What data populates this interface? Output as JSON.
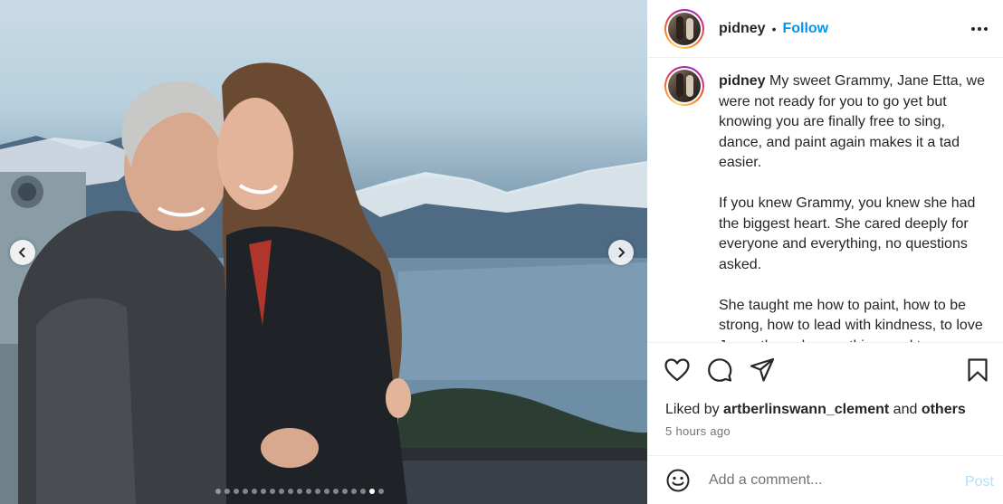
{
  "media": {
    "carousel_total": 19,
    "carousel_active_index": 17,
    "prev_icon": "chevron-left-icon",
    "next_icon": "chevron-right-icon"
  },
  "header": {
    "username": "pidney",
    "separator": "•",
    "follow_label": "Follow",
    "more_icon": "more-options-icon"
  },
  "caption": {
    "username": "pidney",
    "paragraphs": [
      "My sweet Grammy, Jane Etta, we were not ready for you to go yet but knowing you are finally free to sing, dance, and paint again makes it a tad easier.",
      "If you knew Grammy, you knew she had the biggest heart. She cared deeply for everyone and everything, no questions asked.",
      "She taught me how to paint, how to be strong, how to lead with kindness, to love Jesus through everything, and to"
    ]
  },
  "actions": {
    "like_icon": "heart-icon",
    "comment_icon": "comment-icon",
    "share_icon": "share-icon",
    "save_icon": "bookmark-icon"
  },
  "likes": {
    "prefix": "Liked by",
    "user": "artberlinswann_clement",
    "conjunction": "and",
    "others": "others"
  },
  "timestamp": "5 hours ago",
  "comment": {
    "emoji_icon": "emoji-icon",
    "placeholder": "Add a comment...",
    "post_label": "Post"
  },
  "colors": {
    "follow_blue": "#0095f6",
    "post_disabled": "#b2dffc",
    "muted": "#737373",
    "border": "#efefef"
  }
}
